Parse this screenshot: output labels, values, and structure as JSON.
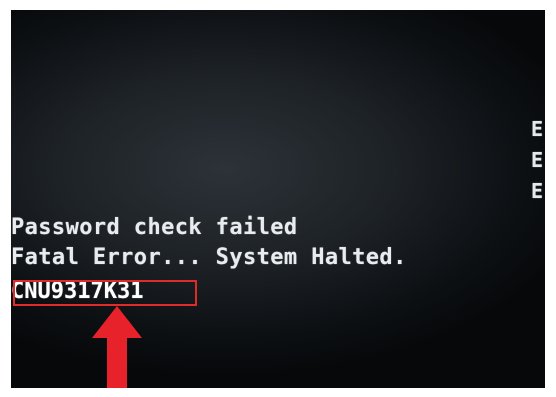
{
  "screen": {
    "edge_chars": [
      "E",
      "E",
      "E"
    ],
    "lines": {
      "password_failed": "Password check failed",
      "fatal_error": "Fatal Error... System Halted."
    },
    "serial_code": "CNU9317K31"
  },
  "annotation": {
    "box_color": "#e02b2b",
    "arrow_color": "#e8222a",
    "arrow_icon": "up-arrow-icon"
  }
}
